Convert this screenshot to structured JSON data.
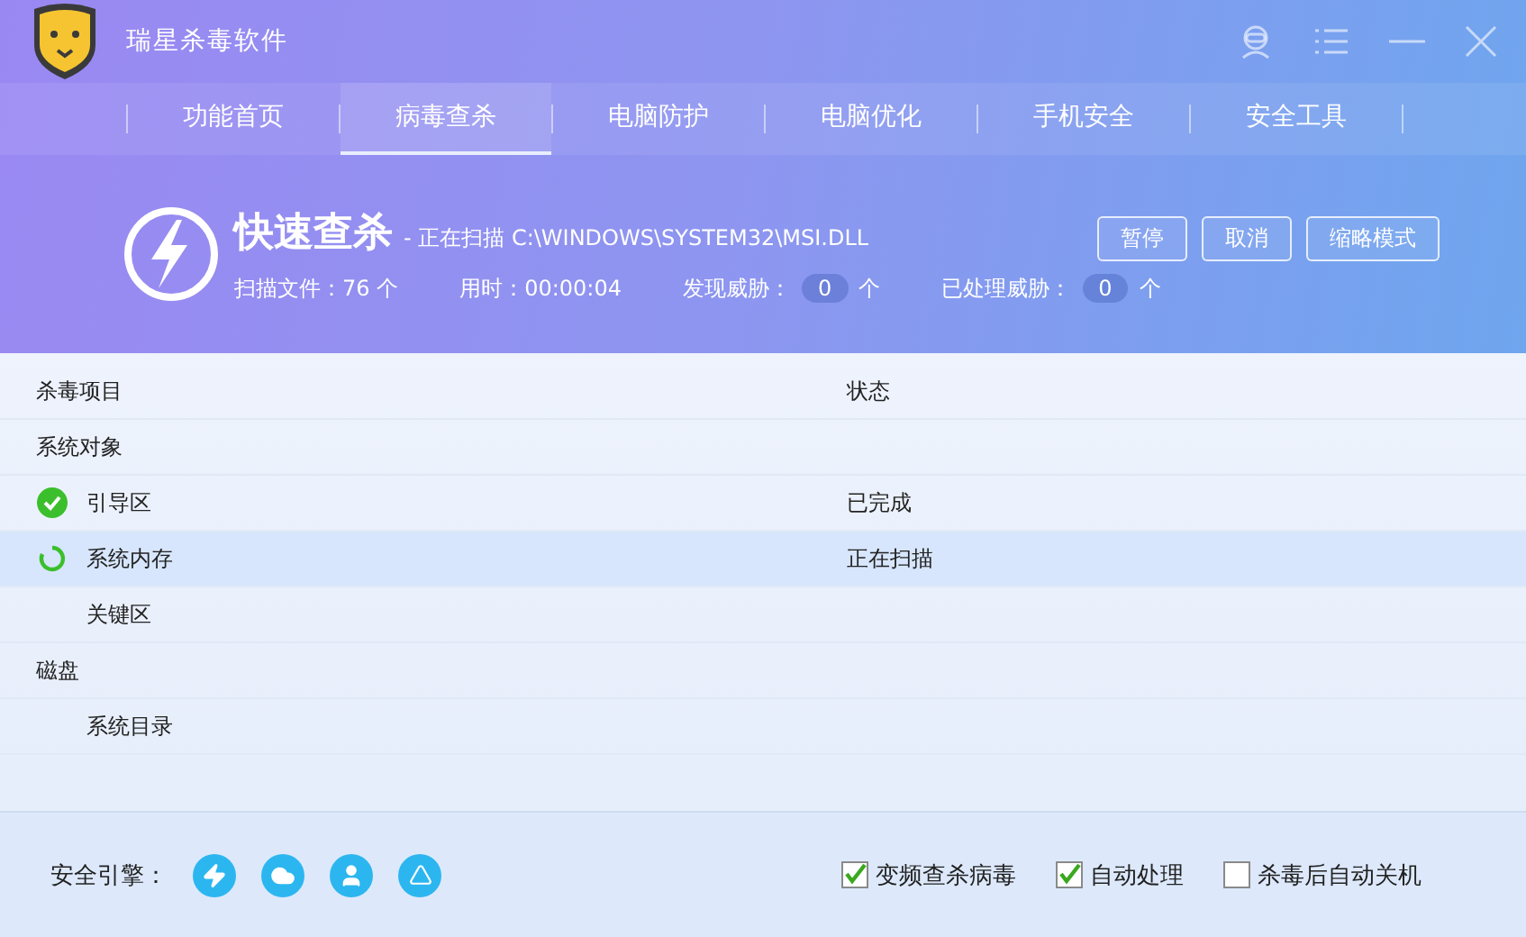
{
  "app": {
    "title": "瑞星杀毒软件"
  },
  "tabs": [
    {
      "label": "功能首页",
      "selected": false
    },
    {
      "label": "病毒查杀",
      "selected": true
    },
    {
      "label": "电脑防护",
      "selected": false
    },
    {
      "label": "电脑优化",
      "selected": false
    },
    {
      "label": "手机安全",
      "selected": false
    },
    {
      "label": "安全工具",
      "selected": false
    }
  ],
  "scan": {
    "title": "快速查杀",
    "current": "- 正在扫描 C:\\WINDOWS\\SYSTEM32\\MSI.DLL",
    "stats": [
      {
        "label": "扫描文件：76 个",
        "kind": "text"
      },
      {
        "label": "用时：00:00:04",
        "kind": "text"
      },
      {
        "label": "发现威胁：",
        "kind": "count",
        "value": "0",
        "unit": "个"
      },
      {
        "label": "已处理威胁：",
        "kind": "count",
        "value": "0",
        "unit": "个"
      }
    ],
    "buttons": [
      "暂停",
      "取消",
      "缩略模式"
    ]
  },
  "table": {
    "columns": [
      "杀毒项目",
      "状态"
    ],
    "rows": [
      {
        "kind": "group",
        "name": "系统对象"
      },
      {
        "kind": "done",
        "name": "引导区",
        "status": "已完成"
      },
      {
        "kind": "scanning",
        "name": "系统内存",
        "status": "正在扫描"
      },
      {
        "kind": "pending",
        "name": "关键区"
      },
      {
        "kind": "group",
        "name": "磁盘"
      },
      {
        "kind": "pending",
        "name": "系统目录"
      }
    ]
  },
  "footer": {
    "engines_label": "安全引擎：",
    "options": [
      {
        "label": "变频查杀病毒",
        "checked": true
      },
      {
        "label": "自动处理",
        "checked": true
      },
      {
        "label": "杀毒后自动关机",
        "checked": false
      }
    ]
  }
}
